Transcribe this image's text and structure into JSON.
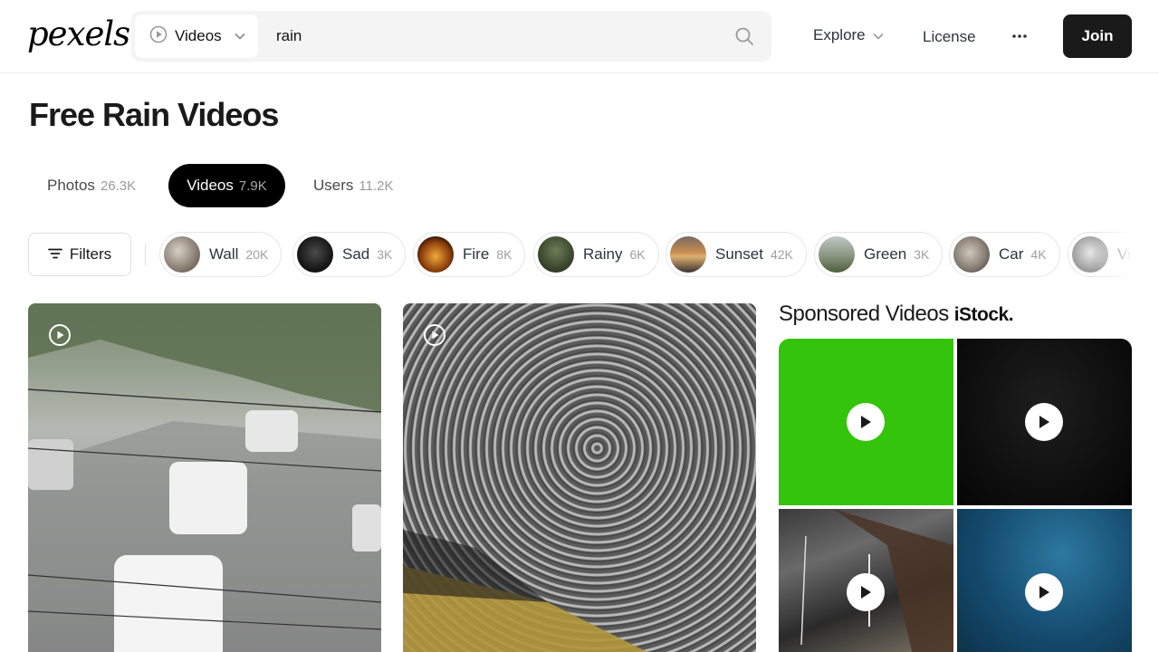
{
  "header": {
    "logo": "pexels",
    "search_type": "Videos",
    "search_query": "rain",
    "nav": {
      "explore": "Explore",
      "license": "License"
    },
    "join_label": "Join"
  },
  "page_title": "Free Rain Videos",
  "tabs": [
    {
      "label": "Photos",
      "count": "26.3K",
      "active": false
    },
    {
      "label": "Videos",
      "count": "7.9K",
      "active": true
    },
    {
      "label": "Users",
      "count": "11.2K",
      "active": false
    }
  ],
  "filters_label": "Filters",
  "chips": [
    {
      "label": "Wall",
      "count": "20K",
      "thumb_color": "#9a8f85"
    },
    {
      "label": "Sad",
      "count": "3K",
      "thumb_color": "#222222"
    },
    {
      "label": "Fire",
      "count": "8K",
      "thumb_color": "#c47a1a"
    },
    {
      "label": "Rainy",
      "count": "6K",
      "thumb_color": "#4b5a3d"
    },
    {
      "label": "Sunset",
      "count": "42K",
      "thumb_color": "#b0784a"
    },
    {
      "label": "Green",
      "count": "3K",
      "thumb_color": "#6e7d5c"
    },
    {
      "label": "Car",
      "count": "4K",
      "thumb_color": "#8a8580"
    },
    {
      "label": "Vi",
      "count": "",
      "thumb_color": "#c9c9c9"
    }
  ],
  "sponsored": {
    "title": "Sponsored Videos",
    "brand": "iStock."
  },
  "colors": {
    "accent": "#05a081",
    "join_bg": "#1a1a1a",
    "active_tab_bg": "#000000"
  }
}
